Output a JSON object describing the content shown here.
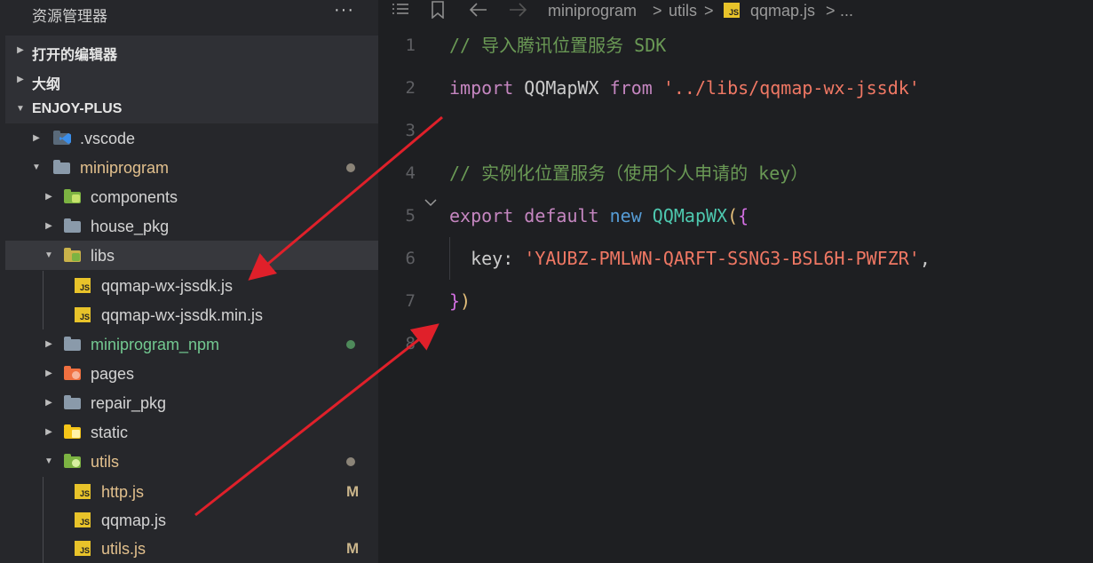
{
  "sidebar": {
    "title": "资源管理器",
    "more": "···",
    "sections": {
      "open_editors": "打开的编辑器",
      "outline": "大纲",
      "project": "ENJOY-PLUS"
    },
    "items": [
      {
        "label": ".vscode"
      },
      {
        "label": "miniprogram"
      },
      {
        "label": "components"
      },
      {
        "label": "house_pkg"
      },
      {
        "label": "libs"
      },
      {
        "label": "qqmap-wx-jssdk.js"
      },
      {
        "label": "qqmap-wx-jssdk.min.js"
      },
      {
        "label": "miniprogram_npm"
      },
      {
        "label": "pages"
      },
      {
        "label": "repair_pkg"
      },
      {
        "label": "static"
      },
      {
        "label": "utils"
      },
      {
        "label": "http.js",
        "badge": "M"
      },
      {
        "label": "qqmap.js"
      },
      {
        "label": "utils.js",
        "badge": "M"
      }
    ],
    "js_tag": "JS"
  },
  "toolbar": {
    "crumbs": [
      "miniprogram",
      "utils",
      "qqmap.js",
      "..."
    ],
    "sep": ">",
    "js_tag": "JS"
  },
  "editor": {
    "line_numbers": [
      "1",
      "2",
      "3",
      "4",
      "5",
      "6",
      "7",
      "8"
    ],
    "l1": "// 导入腾讯位置服务 SDK",
    "l2_kw": "import",
    "l2_id": " QQMapWX ",
    "l2_from": "from",
    "l2_str": " '../libs/qqmap-wx-jssdk'",
    "l4": "// 实例化位置服务（使用个人申请的 key）",
    "l5_export": "export",
    "l5_default": " default",
    "l5_new": " new",
    "l5_cls": " QQMapWX",
    "l5_paren": "(",
    "l5_brace": "{",
    "l6_key": "  key",
    "l6_colon": ": ",
    "l6_str": "'YAUBZ-PMLWN-QARFT-SSNG3-BSL6H-PWFZR'",
    "l6_comma": ",",
    "l7_brace": "}",
    "l7_paren": ")"
  },
  "colors": {
    "accent_arrow": "#e0202a",
    "folder_gray": "#8a9aaa",
    "folder_green": "#7cb342",
    "folder_orange": "#f07040",
    "folder_yellow": "#f5c518",
    "vscode_blue": "#3b8eea"
  }
}
